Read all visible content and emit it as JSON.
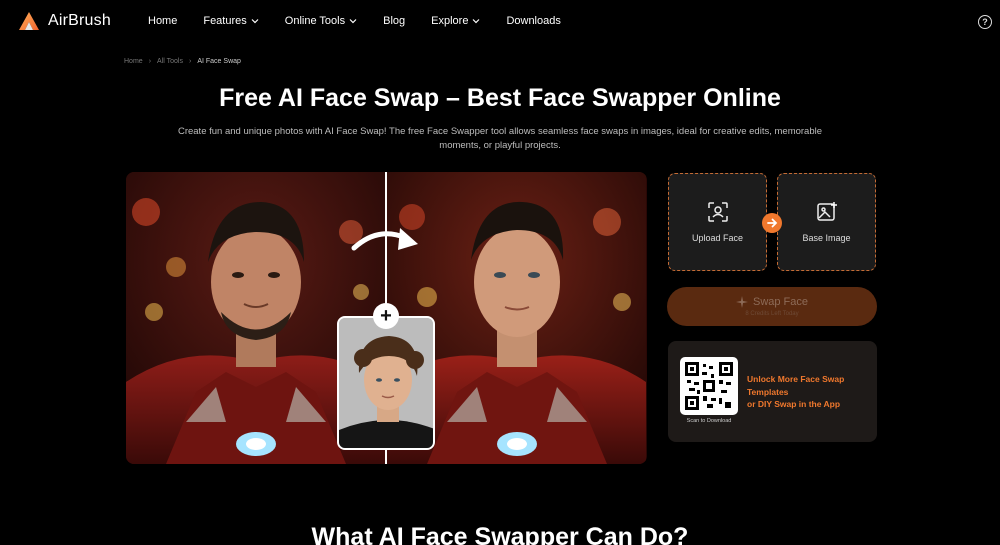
{
  "brand": {
    "name": "AirBrush",
    "accent": "#f0782d"
  },
  "nav": {
    "items": [
      {
        "label": "Home",
        "dropdown": false
      },
      {
        "label": "Features",
        "dropdown": true
      },
      {
        "label": "Online Tools",
        "dropdown": true
      },
      {
        "label": "Blog",
        "dropdown": false
      },
      {
        "label": "Explore",
        "dropdown": true
      },
      {
        "label": "Downloads",
        "dropdown": false
      }
    ],
    "help_icon": "help-circle-icon"
  },
  "breadcrumb": {
    "home": "Home",
    "all_tools": "All Tools",
    "current": "AI Face Swap"
  },
  "hero": {
    "title": "Free AI Face Swap – Best Face Swapper Online",
    "subtitle": "Create fun and unique photos with AI Face Swap! The free Face Swapper tool allows seamless face swaps in images, ideal for creative edits, memorable moments, or playful projects."
  },
  "upload": {
    "upload_face_label": "Upload Face",
    "base_image_label": "Base Image"
  },
  "swap_button": {
    "label": "Swap Face",
    "sublabel": "8 Credits Left Today"
  },
  "promo": {
    "line1": "Unlock More Face Swap Templates",
    "line2": "or DIY Swap in the App",
    "qr_caption": "Scan to Download"
  },
  "section": {
    "heading": "What AI Face Swapper Can Do?"
  }
}
